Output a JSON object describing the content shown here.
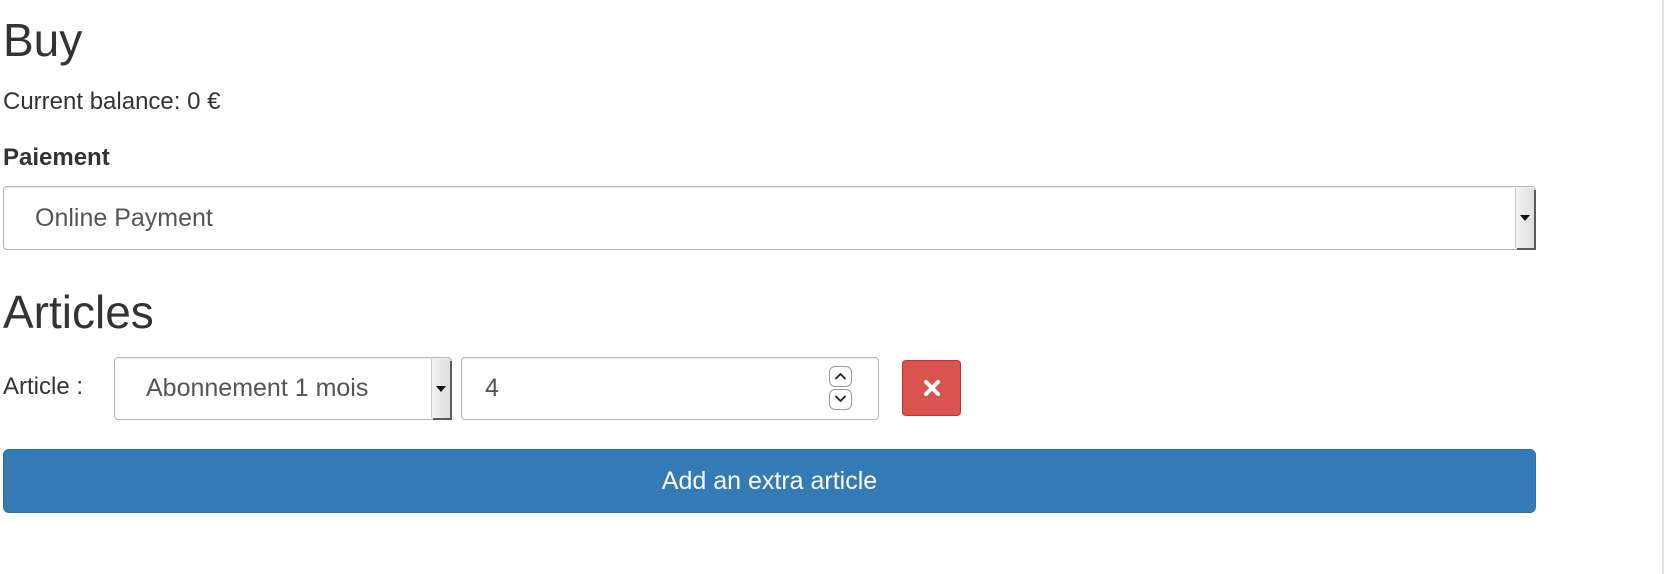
{
  "buy": {
    "title": "Buy",
    "current_balance": "Current balance: 0 €"
  },
  "payment": {
    "label": "Paiement",
    "selected_option": "Online Payment"
  },
  "articles": {
    "title": "Articles",
    "rows": [
      {
        "label": "Article :",
        "article_selected": "Abonnement 1 mois",
        "quantity": "4"
      }
    ],
    "add_button_label": "Add an extra article"
  },
  "colors": {
    "primary": "#337ab7",
    "danger": "#d9534f",
    "text": "#333333"
  },
  "icons": {
    "remove": "times-icon",
    "spin_up": "chevron-up-icon",
    "spin_down": "chevron-down-icon",
    "select_arrow": "caret-down-icon"
  }
}
